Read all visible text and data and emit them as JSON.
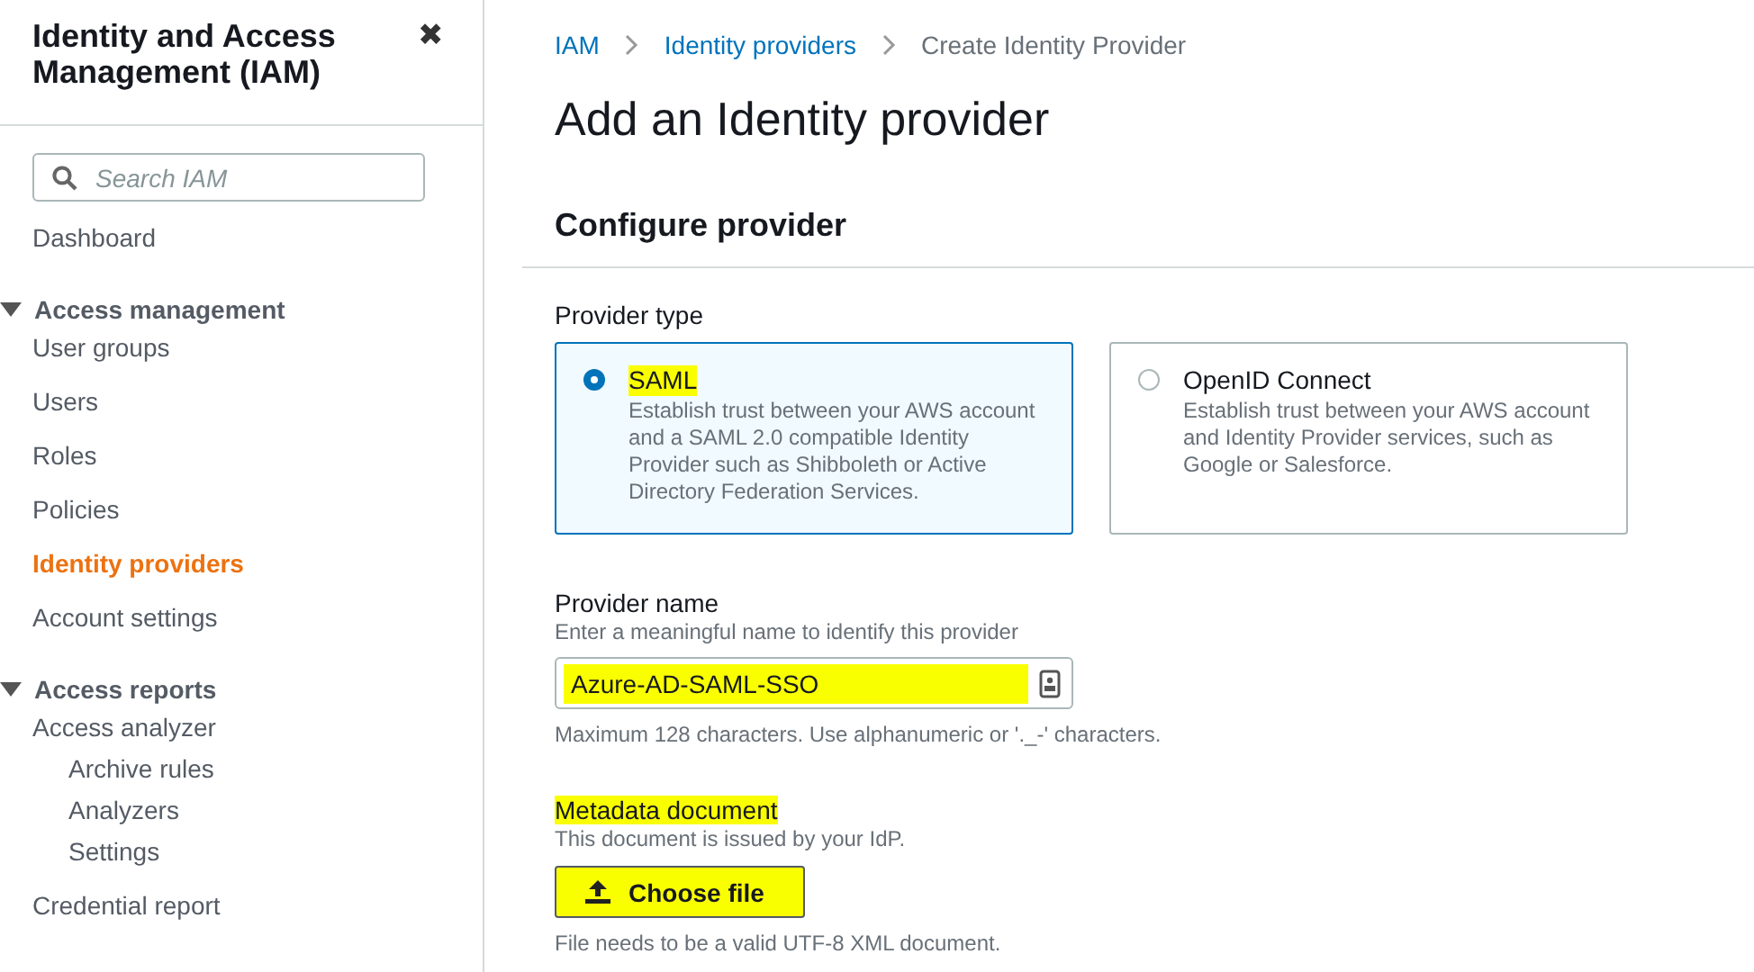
{
  "sidebar": {
    "title": "Identity and Access Management (IAM)",
    "close": "✖",
    "search": {
      "placeholder": "Search IAM"
    },
    "items": [
      {
        "kind": "link",
        "label": "Dashboard",
        "selected": false
      },
      {
        "kind": "section",
        "label": "Access management",
        "expanded": true,
        "children": [
          {
            "kind": "link",
            "label": "User groups",
            "selected": false
          },
          {
            "kind": "link",
            "label": "Users",
            "selected": false
          },
          {
            "kind": "link",
            "label": "Roles",
            "selected": false
          },
          {
            "kind": "link",
            "label": "Policies",
            "selected": false
          },
          {
            "kind": "link",
            "label": "Identity providers",
            "selected": true
          },
          {
            "kind": "link",
            "label": "Account settings",
            "selected": false
          }
        ]
      },
      {
        "kind": "section",
        "label": "Access reports",
        "expanded": true,
        "children": [
          {
            "kind": "link",
            "label": "Access analyzer",
            "selected": false,
            "children": [
              {
                "kind": "link",
                "label": "Archive rules",
                "selected": false
              },
              {
                "kind": "link",
                "label": "Analyzers",
                "selected": false
              },
              {
                "kind": "link",
                "label": "Settings",
                "selected": false
              }
            ]
          },
          {
            "kind": "link",
            "label": "Credential report",
            "selected": false
          }
        ]
      }
    ]
  },
  "breadcrumbs": [
    {
      "label": "IAM",
      "link": true
    },
    {
      "label": "Identity providers",
      "link": true
    },
    {
      "label": "Create Identity Provider",
      "link": false
    }
  ],
  "heading": "Add an Identity provider",
  "section_title": "Configure provider",
  "provider_type": {
    "label": "Provider type",
    "options": [
      {
        "label": "SAML",
        "description": "Establish trust between your AWS account and a SAML 2.0 compatible Identity Provider such as Shibboleth or Active Directory Federation Services.",
        "selected": true,
        "highlighted": true
      },
      {
        "label": "OpenID Connect",
        "description": "Establish trust between your AWS account and Identity Provider services, such as Google or Salesforce.",
        "selected": false,
        "highlighted": false
      }
    ]
  },
  "provider_name": {
    "label": "Provider name",
    "description": "Enter a meaningful name to identify this provider",
    "value": "Azure-AD-SAML-SSO",
    "highlighted": true,
    "hint": "Maximum 128 characters. Use alphanumeric or '._-' characters."
  },
  "metadata": {
    "label": "Metadata document",
    "label_highlighted": true,
    "description": "This document is issued by your IdP.",
    "button": "Choose file",
    "button_highlighted": true,
    "hint": "File needs to be a valid UTF-8 XML document."
  }
}
